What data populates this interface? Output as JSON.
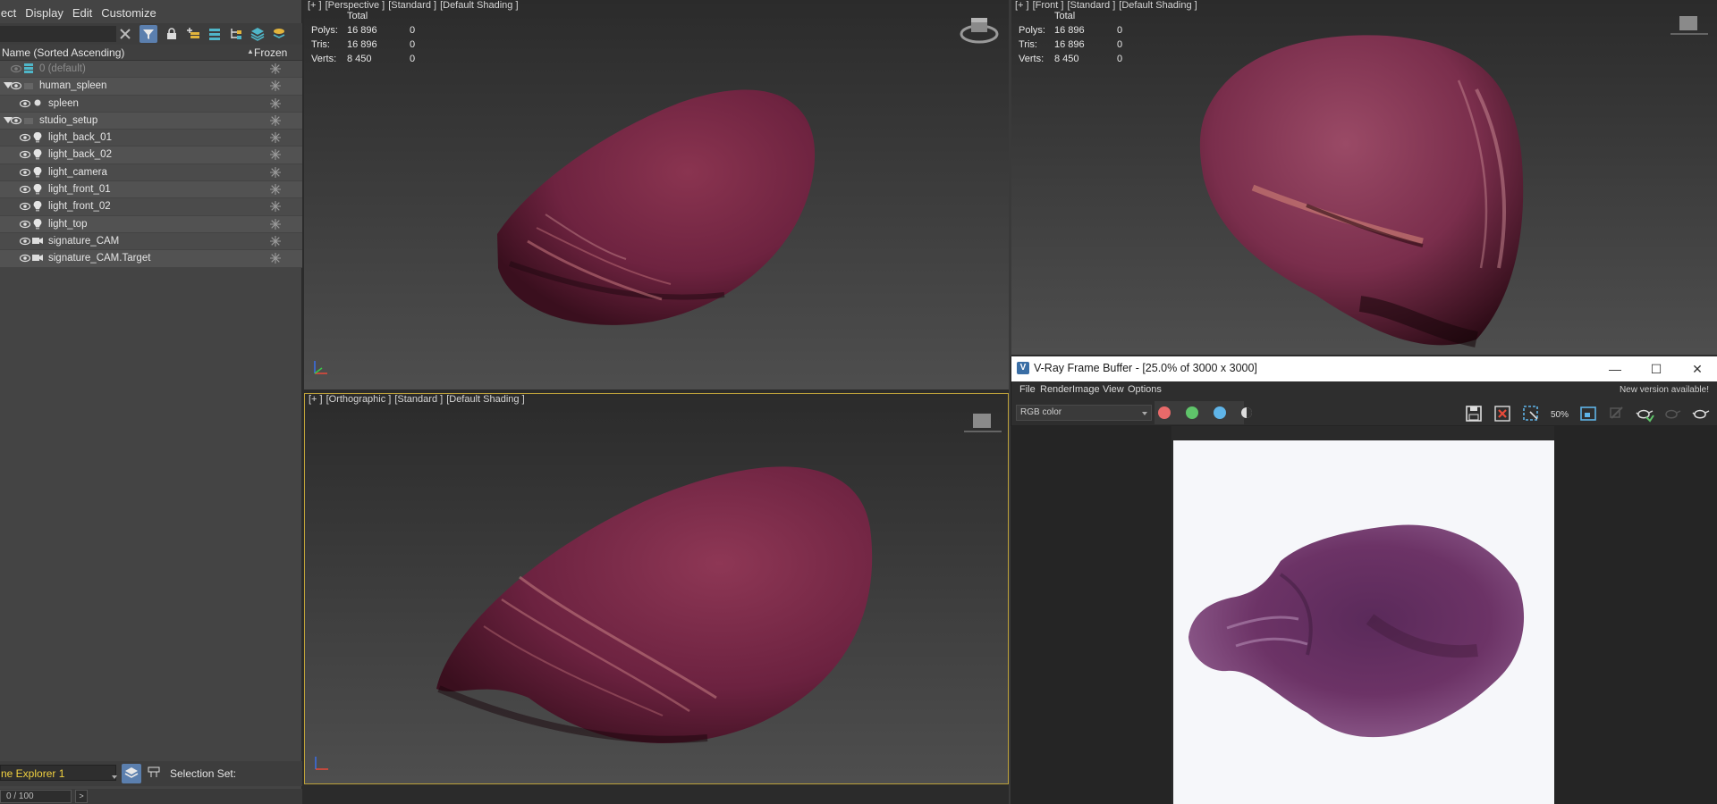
{
  "explorer": {
    "menu": [
      "lect",
      "Display",
      "Edit",
      "Customize"
    ],
    "column_name": "Name (Sorted Ascending)",
    "column_frozen": "Frozen",
    "rows": [
      {
        "label": "0 (default)",
        "indent": 1,
        "type": "layer",
        "dim": true
      },
      {
        "label": "human_spleen",
        "indent": 1,
        "type": "layer-expanded"
      },
      {
        "label": "spleen",
        "indent": 2,
        "type": "object"
      },
      {
        "label": "studio_setup",
        "indent": 1,
        "type": "layer-expanded"
      },
      {
        "label": "light_back_01",
        "indent": 2,
        "type": "light"
      },
      {
        "label": "light_back_02",
        "indent": 2,
        "type": "light"
      },
      {
        "label": "light_camera",
        "indent": 2,
        "type": "light"
      },
      {
        "label": "light_front_01",
        "indent": 2,
        "type": "light"
      },
      {
        "label": "light_front_02",
        "indent": 2,
        "type": "light"
      },
      {
        "label": "light_top",
        "indent": 2,
        "type": "light"
      },
      {
        "label": "signature_CAM",
        "indent": 2,
        "type": "camera"
      },
      {
        "label": "signature_CAM.Target",
        "indent": 2,
        "type": "camera"
      }
    ],
    "explorer_name": "ne Explorer 1",
    "selection_set_label": "Selection Set:",
    "progress": "0 / 100",
    "next_label": ">"
  },
  "viewports": {
    "perspective": {
      "label": [
        "[+ ]",
        "[Perspective ]",
        "[Standard ]",
        "[Default Shading ]"
      ],
      "stats": {
        "header": "Total",
        "rows": [
          [
            "Polys:",
            "16 896",
            "0"
          ],
          [
            "Tris:",
            "16 896",
            "0"
          ],
          [
            "Verts:",
            "8 450",
            "0"
          ]
        ]
      }
    },
    "orthographic": {
      "label": [
        "[+ ]",
        "[Orthographic ]",
        "[Standard ]",
        "[Default Shading ]"
      ]
    },
    "front": {
      "label": [
        "[+ ]",
        "[Front ]",
        "[Standard ]",
        "[Default Shading ]"
      ],
      "stats": {
        "header": "Total",
        "rows": [
          [
            "Polys:",
            "16 896",
            "0"
          ],
          [
            "Tris:",
            "16 896",
            "0"
          ],
          [
            "Verts:",
            "8 450",
            "0"
          ]
        ]
      }
    }
  },
  "vfb": {
    "title": "V-Ray Frame Buffer - [25.0% of 3000 x 3000]",
    "menu": [
      "File",
      "Render",
      "Image",
      "View",
      "Options"
    ],
    "new_version": "New version available!",
    "channel": "RGB color",
    "channel_colors": {
      "red": "#e86a6a",
      "green": "#5fc46a",
      "blue": "#5fb4e8"
    },
    "zoom_label": "50%"
  },
  "colors": {
    "accent_active": "#5b7fae",
    "selected_viewport_border": "#bda13a",
    "explorer_name_color": "#f0d040",
    "spleen_base": "#6e1f35"
  }
}
